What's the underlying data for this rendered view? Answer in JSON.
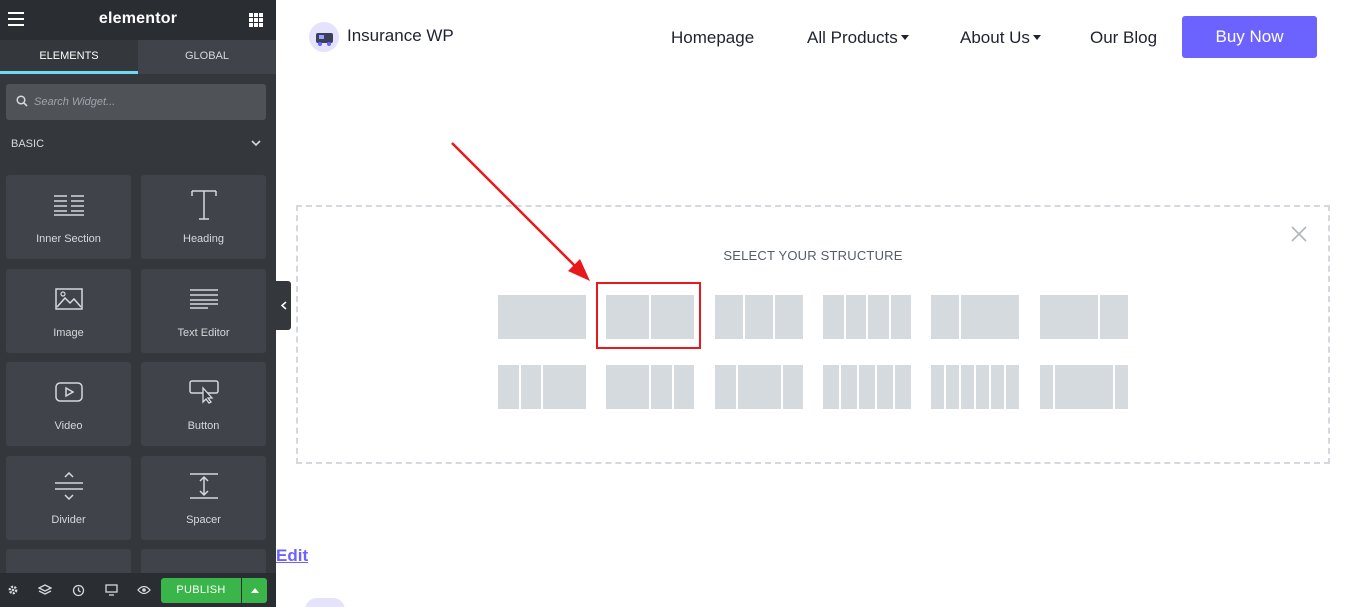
{
  "panel": {
    "logo": "elementor",
    "tabs": [
      "ELEMENTS",
      "GLOBAL"
    ],
    "search_placeholder": "Search Widget...",
    "category": "BASIC",
    "widgets": [
      {
        "label": "Inner Section",
        "icon": "inner-section-icon"
      },
      {
        "label": "Heading",
        "icon": "heading-icon"
      },
      {
        "label": "Image",
        "icon": "image-icon"
      },
      {
        "label": "Text Editor",
        "icon": "text-editor-icon"
      },
      {
        "label": "Video",
        "icon": "video-icon"
      },
      {
        "label": "Button",
        "icon": "button-icon"
      },
      {
        "label": "Divider",
        "icon": "divider-icon"
      },
      {
        "label": "Spacer",
        "icon": "spacer-icon"
      }
    ],
    "publish_label": "PUBLISH",
    "colors": {
      "panel_bg": "#34383c",
      "accent": "#71d7f7",
      "publish": "#39b54a"
    }
  },
  "site": {
    "name": "Insurance WP",
    "nav": [
      {
        "label": "Homepage",
        "dropdown": false
      },
      {
        "label": "All Products",
        "dropdown": true
      },
      {
        "label": "About Us",
        "dropdown": true
      },
      {
        "label": "Our Blog",
        "dropdown": false
      }
    ],
    "cta_label": "Buy Now",
    "cta_color": "#6c63ff"
  },
  "structure": {
    "title": "SELECT YOUR STRUCTURE",
    "selected_index": 1,
    "highlight_color": "#e8191c",
    "presets_row1": [
      [
        100
      ],
      [
        50,
        50
      ],
      [
        33,
        33,
        33
      ],
      [
        25,
        25,
        25,
        25
      ],
      [
        33,
        66
      ],
      [
        66,
        33
      ]
    ],
    "presets_row2": [
      [
        25,
        25,
        50
      ],
      [
        50,
        25,
        25
      ],
      [
        25,
        50,
        25
      ],
      [
        20,
        20,
        20,
        20,
        20
      ],
      [
        16,
        16,
        16,
        16,
        16,
        16
      ],
      [
        16,
        66,
        16
      ]
    ]
  },
  "edit_link": "Edit"
}
